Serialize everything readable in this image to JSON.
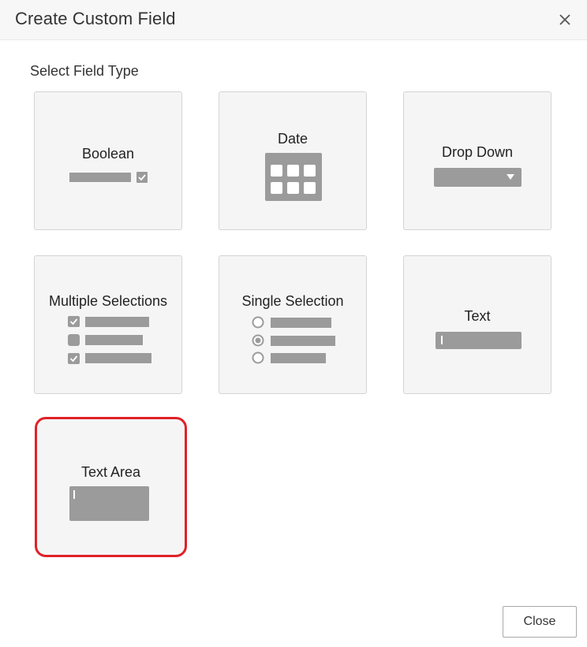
{
  "dialog": {
    "title": "Create Custom Field",
    "close_icon": "close-icon"
  },
  "section_label": "Select Field Type",
  "field_types": [
    {
      "label": "Boolean",
      "icon": "boolean-icon",
      "selected": false
    },
    {
      "label": "Date",
      "icon": "calendar-icon",
      "selected": false
    },
    {
      "label": "Drop Down",
      "icon": "dropdown-icon",
      "selected": false
    },
    {
      "label": "Multiple Selections",
      "icon": "checkbox-list-icon",
      "selected": false
    },
    {
      "label": "Single Selection",
      "icon": "radio-list-icon",
      "selected": false
    },
    {
      "label": "Text",
      "icon": "text-input-icon",
      "selected": false
    },
    {
      "label": "Text Area",
      "icon": "text-area-icon",
      "selected": true
    }
  ],
  "footer": {
    "close_label": "Close"
  },
  "colors": {
    "selected_border": "#e02127",
    "tile_background": "#f5f5f5",
    "icon_grey": "#9b9b9b"
  }
}
